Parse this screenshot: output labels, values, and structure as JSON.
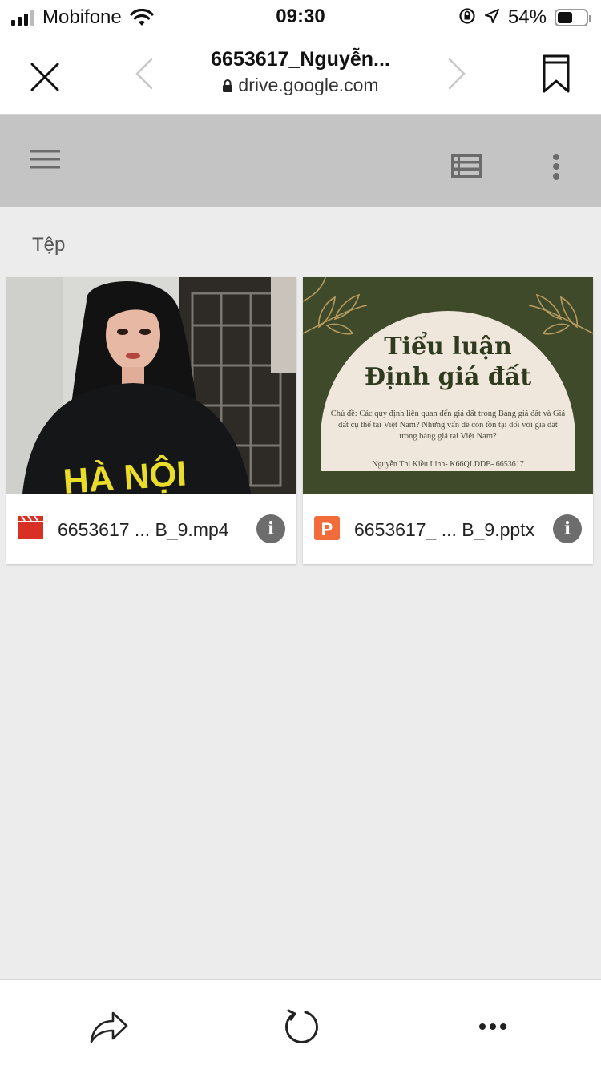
{
  "status": {
    "carrier": "Mobifone",
    "time": "09:30",
    "battery": "54%",
    "battery_level": 0.54
  },
  "header": {
    "title": "6653617_Nguyễn...",
    "url": "drive.google.com"
  },
  "section_label": "Tệp",
  "files": [
    {
      "name": "6653617 ... B_9.mp4",
      "type": "video"
    },
    {
      "name": "6653617_ ... B_9.pptx",
      "type": "presentation"
    }
  ],
  "slide_preview": {
    "title_line1": "Tiểu luận",
    "title_line2": "Định giá đất",
    "subtitle": "Chủ đề: Các quy định liên quan đến giá đất trong Bảng giá đất và Giá đất cụ thể tại Việt Nam? Những vấn đề còn tồn tại đối với giá đất trong bảng giá tại Việt Nam?",
    "author": "Nguyễn Thị Kiều Linh- K66QLDDB- 6653617"
  },
  "colors": {
    "video_icon": "#d93025",
    "pptx_icon": "#f26b3a",
    "toolbar": "#c4c4c4"
  }
}
